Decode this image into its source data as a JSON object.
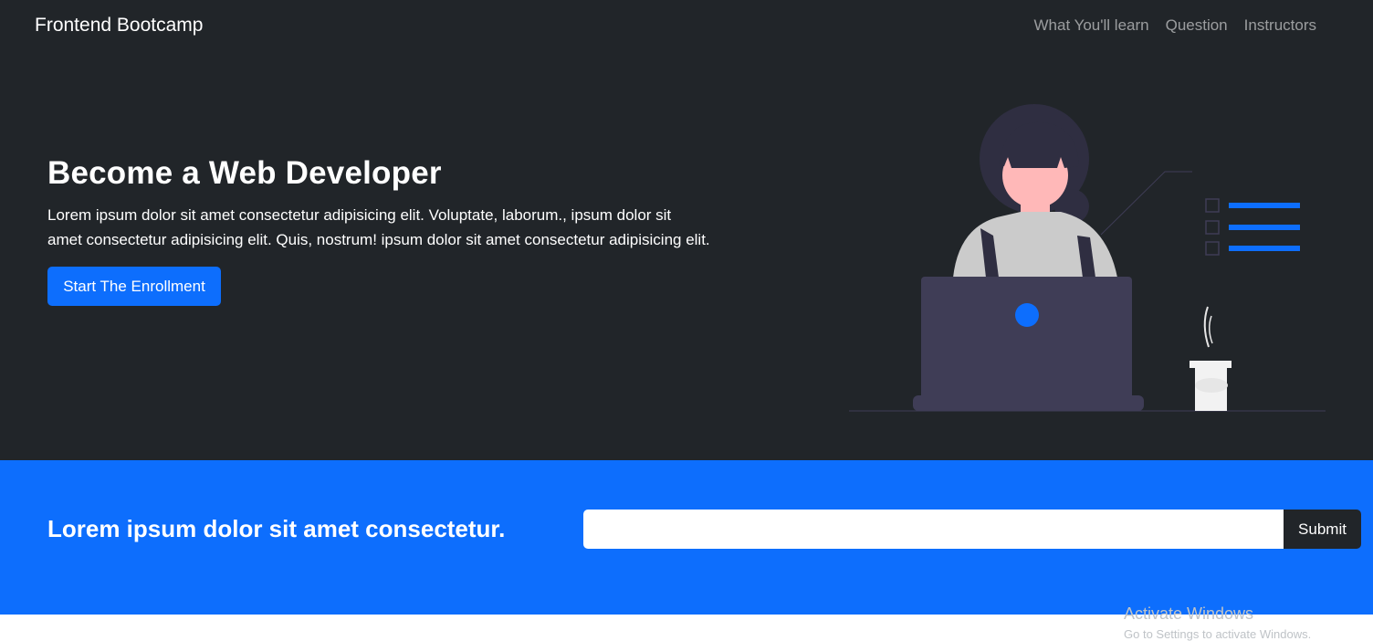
{
  "navbar": {
    "brand": "Frontend Bootcamp",
    "links": [
      "What You'll learn",
      "Question",
      "Instructors"
    ]
  },
  "hero": {
    "title": "Become a Web Developer",
    "lead_line1": "Lorem ipsum dolor sit amet consectetur adipisicing elit. Voluptate, laborum., ipsum dolor sit",
    "lead_line2": "amet consectetur adipisicing elit. Quis, nostrum! ipsum dolor sit amet consectetur adipisicing elit.",
    "cta_label": "Start The Enrollment"
  },
  "newsletter": {
    "text": "Lorem ipsum dolor sit amet consectetur.",
    "input_value": "",
    "submit_label": "Submit"
  },
  "watermark": {
    "title": "Activate Windows",
    "subtitle": "Go to Settings to activate Windows."
  },
  "colors": {
    "dark": "#212529",
    "primary": "#0d6efd",
    "laptop": "#3f3d56",
    "skin": "#ffb8b8",
    "hair": "#2f2e41"
  },
  "icons": [
    "checkbox-icon",
    "list-line-icon",
    "laptop-logo-icon",
    "coffee-cup-icon"
  ]
}
